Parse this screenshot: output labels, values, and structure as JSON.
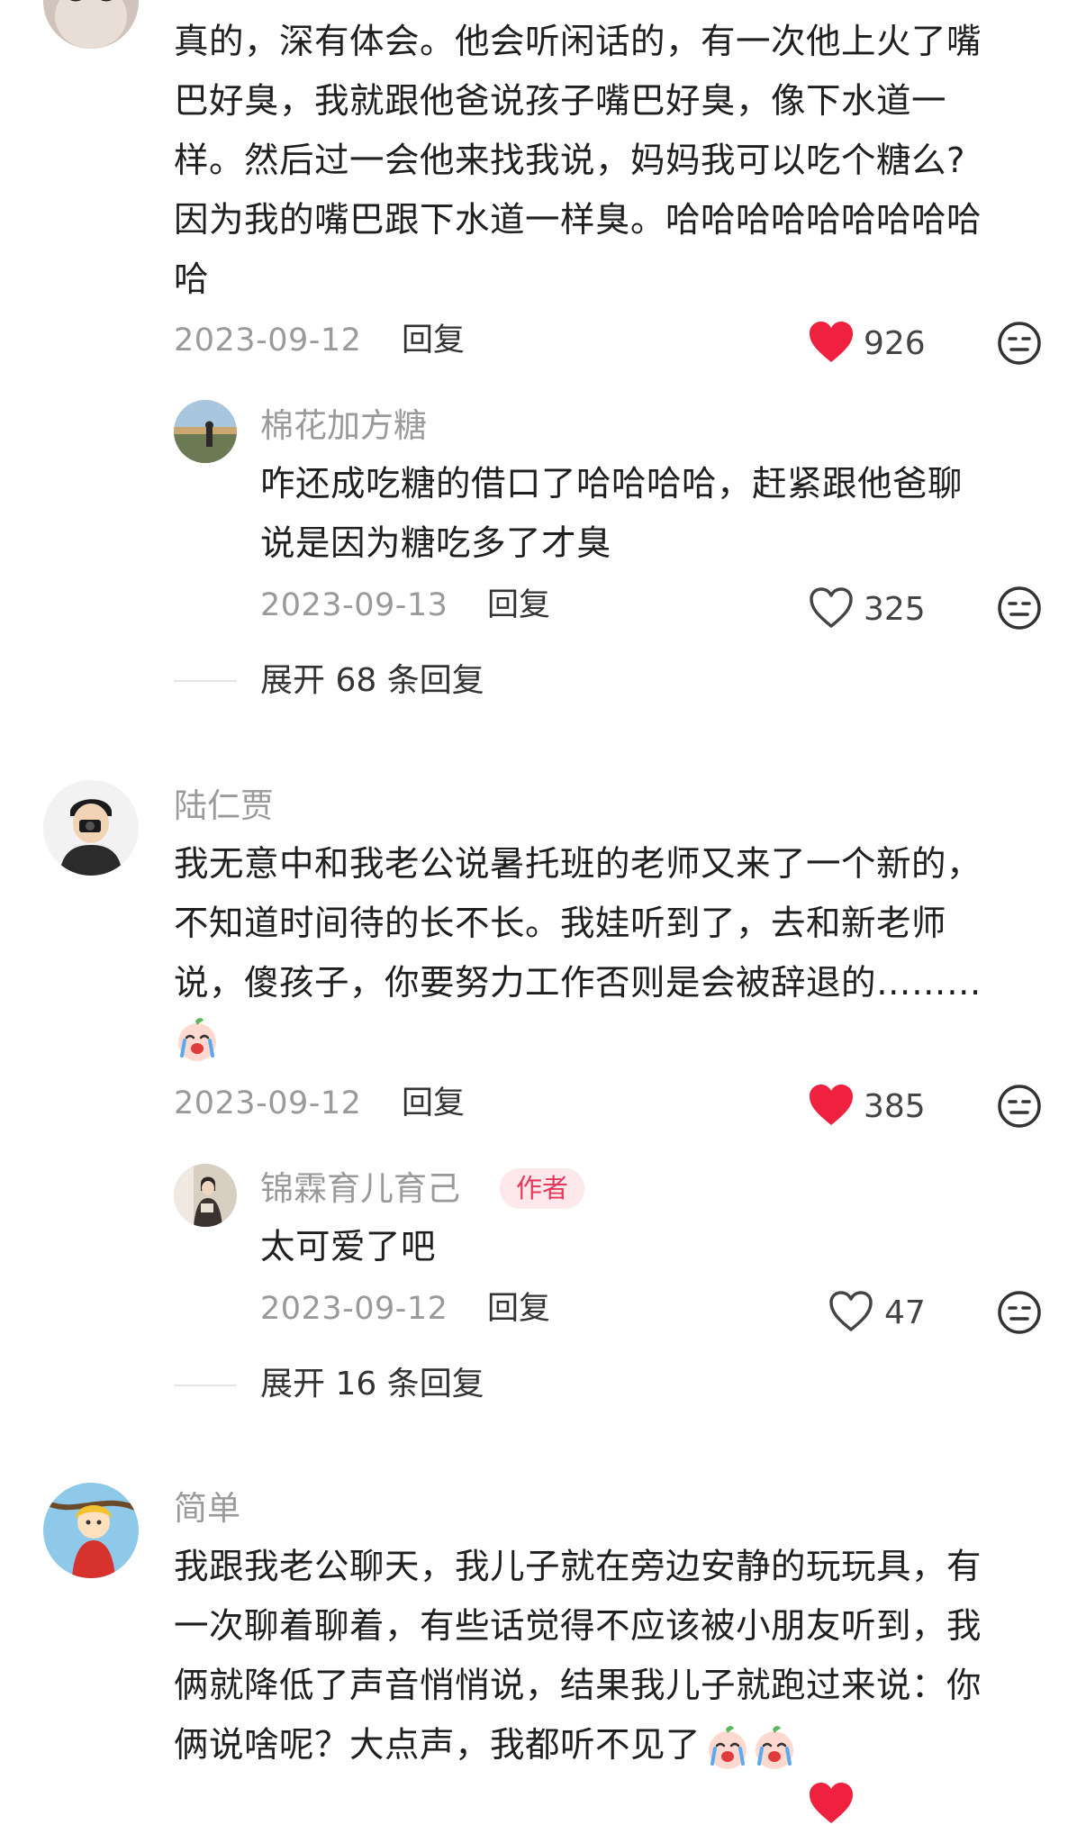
{
  "comments": [
    {
      "lines": [
        "真的，深有体会。他会听闲话的，有一次他上火了嘴",
        "巴好臭，我就跟他爸说孩子嘴巴好臭，像下水道一",
        "样。然后过一会他来找我说，妈妈我可以吃个糖么?",
        "因为我的嘴巴跟下水道一样臭。哈哈哈哈哈哈哈哈哈",
        "哈"
      ],
      "date": "2023-09-12",
      "reply_label": "回复",
      "likes": "926",
      "liked": true,
      "reply": {
        "name": "棉花加方糖",
        "lines": [
          "咋还成吃糖的借口了哈哈哈哈，赶紧跟他爸聊",
          "说是因为糖吃多了才臭"
        ],
        "date": "2023-09-13",
        "reply_label": "回复",
        "likes": "325",
        "liked": false
      },
      "expand_label": "展开 68 条回复"
    },
    {
      "name": "陆仁贾",
      "lines": [
        "我无意中和我老公说暑托班的老师又来了一个新的，",
        "不知道时间待的长不长。我娃听到了，去和新老师",
        "说，傻孩子，你要努力工作否则是会被辞退的………"
      ],
      "date": "2023-09-12",
      "reply_label": "回复",
      "likes": "385",
      "liked": true,
      "reply": {
        "name": "锦霖育儿育己",
        "badge": "作者",
        "lines": [
          "太可爱了吧"
        ],
        "date": "2023-09-12",
        "reply_label": "回复",
        "likes": "47",
        "liked": false
      },
      "expand_label": "展开 16 条回复"
    },
    {
      "name": "简单",
      "lines": [
        "我跟我老公聊天，我儿子就在旁边安静的玩玩具，有",
        "一次聊着聊着，有些话觉得不应该被小朋友听到，我",
        "俩就降低了声音悄悄说，结果我儿子就跑过来说：你",
        "俩说啥呢？大点声，我都听不见了"
      ]
    }
  ],
  "colors": {
    "like_red": "#f0213f",
    "badge_bg": "#fde8ec",
    "badge_text": "#e8385a",
    "muted": "#9a9a9a"
  },
  "icons": [
    "heart-icon",
    "heart-outline-icon",
    "expressionless-face-icon",
    "crying-emoji-icon"
  ]
}
